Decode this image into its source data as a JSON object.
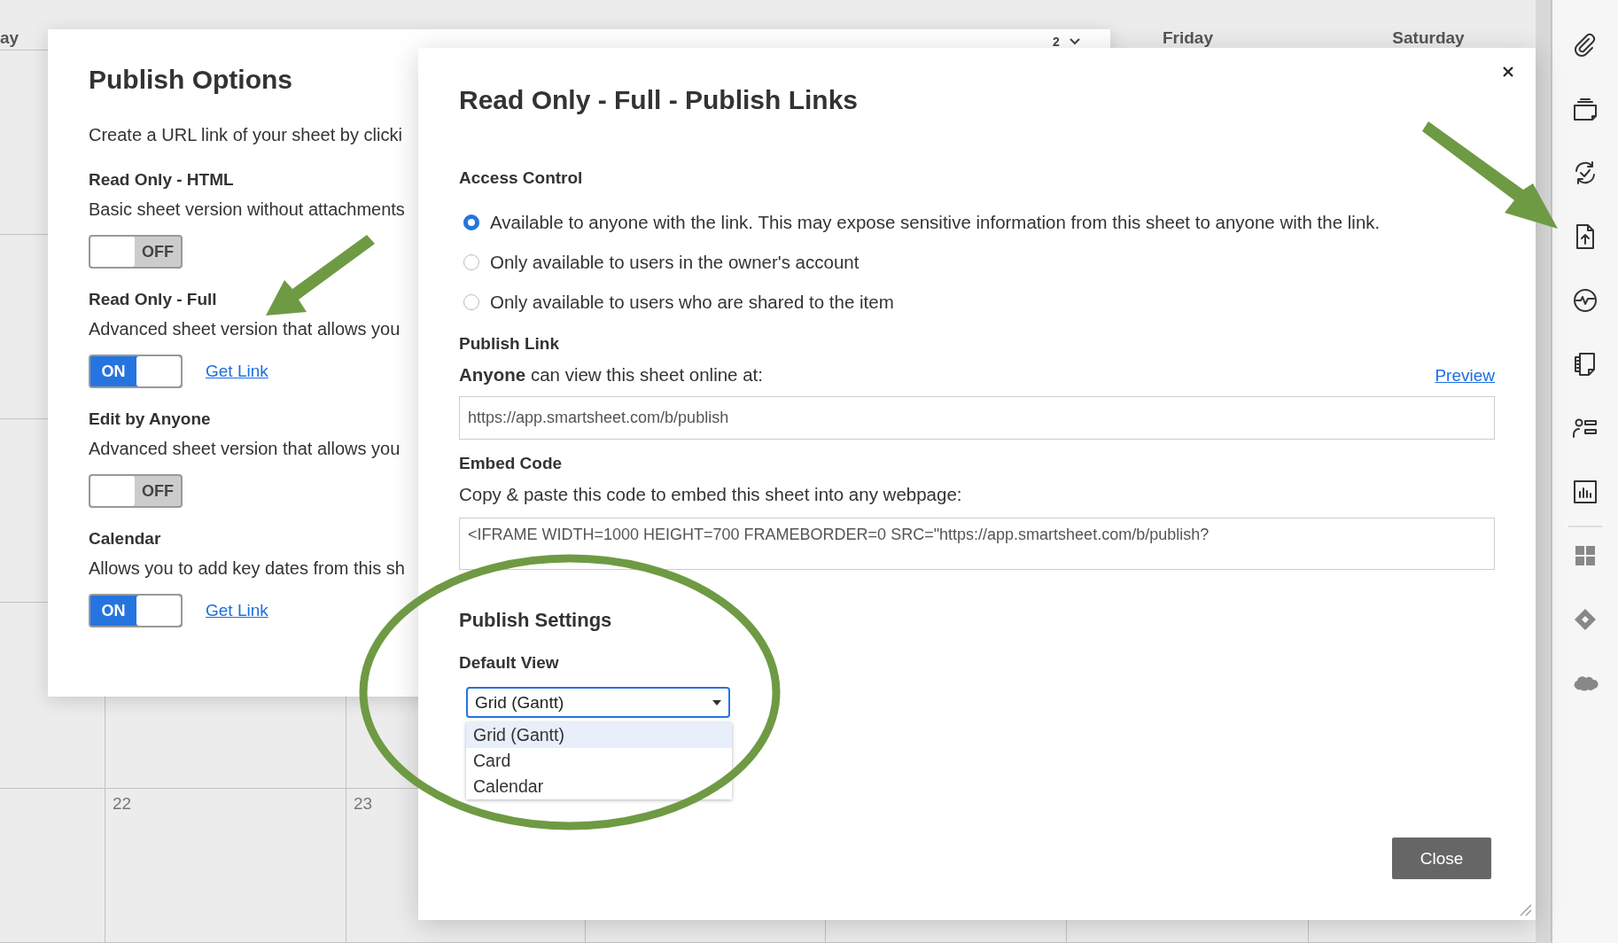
{
  "calendar": {
    "day_headers": [
      "ay",
      "Friday",
      "Saturday"
    ],
    "nav_label": "2",
    "day_numbers": [
      "22",
      "23"
    ]
  },
  "publish_options": {
    "title": "Publish Options",
    "intro": "Create a URL link of your sheet by clicki",
    "options": [
      {
        "title": "Read Only - HTML",
        "description": "Basic sheet version without attachments",
        "on": false,
        "toggle_label": "OFF"
      },
      {
        "title": "Read Only - Full",
        "description": "Advanced sheet version that allows you",
        "on": true,
        "toggle_label": "ON",
        "link": "Get Link"
      },
      {
        "title": "Edit by Anyone",
        "description": "Advanced sheet version that allows you",
        "on": false,
        "toggle_label": "OFF"
      },
      {
        "title": "Calendar",
        "description": "Allows you to add key dates from this sh",
        "on": true,
        "toggle_label": "ON",
        "link": "Get Link"
      }
    ]
  },
  "dialog": {
    "title": "Read Only - Full - Publish Links",
    "access_control": {
      "heading": "Access Control",
      "options": [
        {
          "label": "Available to anyone with the link. This may expose sensitive information from this sheet to anyone with the link.",
          "selected": true
        },
        {
          "label": "Only available to users in the owner's account",
          "selected": false
        },
        {
          "label": "Only available to users who are shared to the item",
          "selected": false
        }
      ]
    },
    "publish_link": {
      "heading": "Publish Link",
      "caption": "**Anyone** can view this sheet online at:",
      "preview": "Preview",
      "url": "https://app.smartsheet.com/b/publish"
    },
    "embed": {
      "heading": "Embed Code",
      "caption": "Copy & paste this code to embed this sheet into any webpage:",
      "code": "<IFRAME WIDTH=1000 HEIGHT=700 FRAMEBORDER=0 SRC=\"https://app.smartsheet.com/b/publish?"
    },
    "settings": {
      "heading": "Publish Settings",
      "default_view_label": "Default View",
      "value": "Grid (Gantt)",
      "options": [
        {
          "label": "Grid (Gantt)",
          "selected": true
        },
        {
          "label": "Card",
          "selected": false
        },
        {
          "label": "Calendar",
          "selected": false
        }
      ]
    },
    "close": "Close"
  },
  "sidebar": {
    "items": [
      {
        "kind": "paperclip"
      },
      {
        "kind": "stack"
      },
      {
        "kind": "sync"
      },
      {
        "kind": "upload"
      },
      {
        "kind": "activity"
      },
      {
        "kind": "pages"
      },
      {
        "kind": "contacts"
      },
      {
        "kind": "chart"
      },
      {
        "kind": "grid"
      },
      {
        "kind": "diamond"
      },
      {
        "kind": "cloud"
      }
    ]
  }
}
